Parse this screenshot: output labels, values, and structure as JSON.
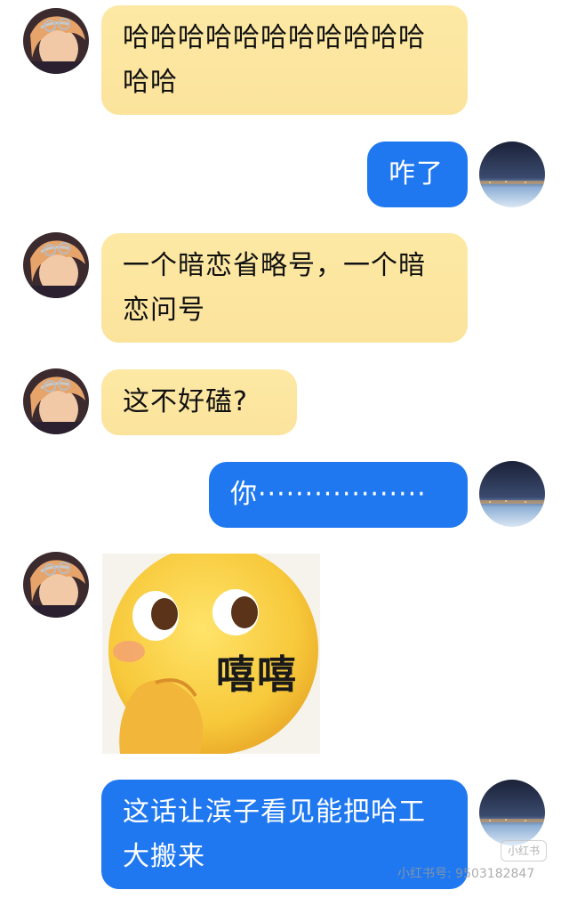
{
  "messages": [
    {
      "side": "in",
      "type": "text",
      "text": "哈哈哈哈哈哈哈哈哈哈哈哈哈"
    },
    {
      "side": "out",
      "type": "text",
      "text": "咋了"
    },
    {
      "side": "in",
      "type": "text",
      "text": "一个暗恋省略号，一个暗恋问号"
    },
    {
      "side": "in",
      "type": "text",
      "text": "这不好磕?"
    },
    {
      "side": "out",
      "type": "text",
      "text": "你··················"
    },
    {
      "side": "in",
      "type": "sticker",
      "sticker_text": "嘻嘻"
    },
    {
      "side": "out",
      "type": "text",
      "text": "这话让滨子看见能把哈工大搬来"
    }
  ],
  "watermark": {
    "text": "小红书号: 9503182847",
    "badge": "小红书"
  },
  "colors": {
    "incoming_bubble": "#fbe39c",
    "outgoing_bubble": "#1f78f0",
    "background": "#ffffff"
  }
}
